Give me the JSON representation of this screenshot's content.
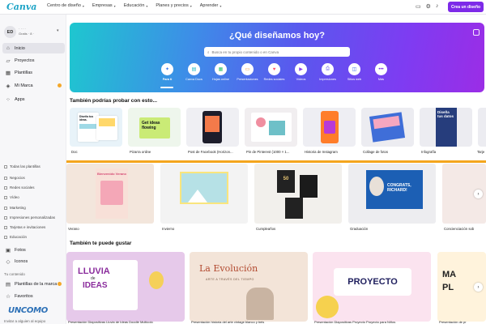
{
  "app": {
    "logo": "Canva"
  },
  "topnav": {
    "items": [
      "Centro de diseño",
      "Empresas",
      "Educación",
      "Planes y precios",
      "Aprender"
    ],
    "cta": "Crea un diseño"
  },
  "sidebar": {
    "avatar": "ED",
    "account_line1": "· · · ·",
    "account_line2": "Gratis · 8 ·",
    "items": [
      {
        "label": "Inicio",
        "icon": "home-icon"
      },
      {
        "label": "Proyectos",
        "icon": "folder-icon"
      },
      {
        "label": "Plantillas",
        "icon": "template-icon"
      },
      {
        "label": "Mi Marca",
        "icon": "brand-icon"
      },
      {
        "label": "Apps",
        "icon": "apps-icon"
      }
    ],
    "filters": [
      "Todas las plantillas",
      "Negocios",
      "Redes sociales",
      "Vídeo",
      "Marketing",
      "Impresiones personalizadas",
      "Tarjetas e invitaciones",
      "Educación"
    ],
    "more": [
      {
        "label": "Fotos"
      },
      {
        "label": "Iconos"
      }
    ],
    "section_label": "Tu contenido",
    "brand_label": "Plantillas de la marca",
    "fav_label": "Favoritos",
    "watermark": "UNCOMO",
    "bottom": "Invitar a alguien al equipo"
  },
  "hero": {
    "title": "¿Qué diseñamos hoy?",
    "search_placeholder": "Busca en tu propio contenido o en Canva",
    "categories": [
      {
        "label": "Para ti",
        "icon": "sparkle-icon",
        "color": "#3a7bf0"
      },
      {
        "label": "Canva Docs",
        "icon": "doc-icon",
        "color": "#1eb7c6"
      },
      {
        "label": "Hojas online",
        "icon": "sheet-icon",
        "color": "#2ec26d"
      },
      {
        "label": "Presentaciones",
        "icon": "presentation-icon",
        "color": "#f58a1f"
      },
      {
        "label": "Redes sociales",
        "icon": "heart-icon",
        "color": "#ff4f6d"
      },
      {
        "label": "Vídeos",
        "icon": "video-icon",
        "color": "#8a3ff0"
      },
      {
        "label": "Impresiones",
        "icon": "print-icon",
        "color": "#6b5cf0"
      },
      {
        "label": "Sitios web",
        "icon": "web-icon",
        "color": "#3b66e8"
      },
      {
        "label": "Más",
        "icon": "more-icon",
        "color": "#7d2ae8"
      }
    ]
  },
  "section1": {
    "title": "También podrías probar con esto...",
    "cards": [
      "Doc",
      "Pizarra online",
      "Post de Facebook (Horizon...",
      "Pin de Pinterest (1000 × 1...",
      "Historia de Instagram",
      "Collage de fotos",
      "Infografía",
      "Tarje"
    ],
    "doc_text": "Diseña tus ideas.",
    "whiteboard_text": "Get ideas flowing",
    "infographic_text": "Diseña tus datos"
  },
  "section2": {
    "cards": [
      "Verano",
      "Invierno",
      "Cumpleaños",
      "Graduación",
      "Concienciación sob"
    ],
    "graduation_text": "CONGRATS, RICHARD!",
    "summer_text": "Bienvenido Verano",
    "birthday_text": "50"
  },
  "section3": {
    "title": "También te puede gustar",
    "cards": [
      {
        "label": "Presentación Diapositivas Lluvia de Ideas Doodle Multicolo",
        "text1": "LLUVIA",
        "text2": "de",
        "text3": "IDEAS"
      },
      {
        "label": "Presentación historia del arte vintage blanco y beis",
        "text1": "La Evolución",
        "text2": "ARTE A TRAVÉS DEL TIEMPO"
      },
      {
        "label": "Presentación Diapositivas Proyecto Proyecto para Niños",
        "text1": "PROYECTO"
      },
      {
        "label": "Presentación de pr",
        "text1": "MA",
        "text2": "PL"
      }
    ]
  }
}
